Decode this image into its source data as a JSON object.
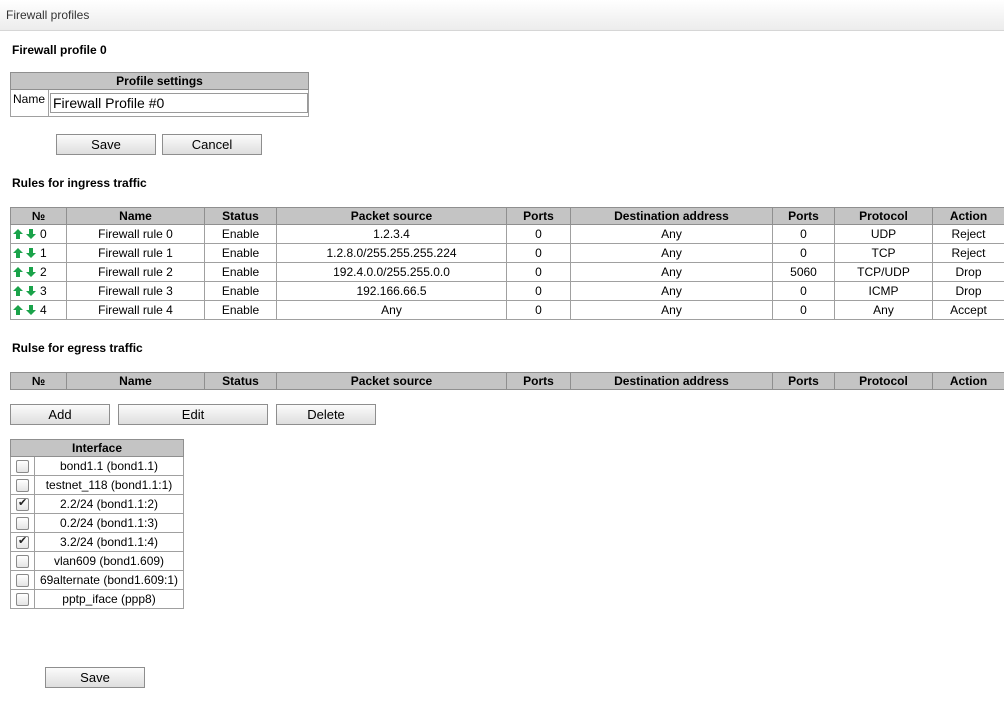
{
  "page": {
    "title": "Firewall profiles"
  },
  "profile": {
    "heading": "Firewall profile 0"
  },
  "profile_settings": {
    "header": "Profile settings",
    "name_label": "Name",
    "name_value": "Firewall Profile #0"
  },
  "buttons": {
    "save": "Save",
    "cancel": "Cancel",
    "add": "Add",
    "edit": "Edit",
    "delete": "Delete",
    "save_bottom": "Save"
  },
  "ingress": {
    "heading": "Rules for ingress traffic",
    "columns": [
      "№",
      "Name",
      "Status",
      "Packet source",
      "Ports",
      "Destination address",
      "Ports",
      "Protocol",
      "Action"
    ],
    "rows": [
      {
        "num": "0",
        "name": "Firewall rule 0",
        "status": "Enable",
        "source": "1.2.3.4",
        "src_ports": "0",
        "dest": "Any",
        "dst_ports": "0",
        "protocol": "UDP",
        "action": "Reject"
      },
      {
        "num": "1",
        "name": "Firewall rule 1",
        "status": "Enable",
        "source": "1.2.8.0/255.255.255.224",
        "src_ports": "0",
        "dest": "Any",
        "dst_ports": "0",
        "protocol": "TCP",
        "action": "Reject"
      },
      {
        "num": "2",
        "name": "Firewall rule 2",
        "status": "Enable",
        "source": "192.4.0.0/255.255.0.0",
        "src_ports": "0",
        "dest": "Any",
        "dst_ports": "5060",
        "protocol": "TCP/UDP",
        "action": "Drop"
      },
      {
        "num": "3",
        "name": "Firewall rule 3",
        "status": "Enable",
        "source": "192.166.66.5",
        "src_ports": "0",
        "dest": "Any",
        "dst_ports": "0",
        "protocol": "ICMP",
        "action": "Drop"
      },
      {
        "num": "4",
        "name": "Firewall rule 4",
        "status": "Enable",
        "source": "Any",
        "src_ports": "0",
        "dest": "Any",
        "dst_ports": "0",
        "protocol": "Any",
        "action": "Accept"
      }
    ]
  },
  "egress": {
    "heading": "Rulse for egress traffic",
    "columns": [
      "№",
      "Name",
      "Status",
      "Packet source",
      "Ports",
      "Destination address",
      "Ports",
      "Protocol",
      "Action"
    ]
  },
  "interfaces": {
    "header": "Interface",
    "items": [
      {
        "label": "bond1.1 (bond1.1)",
        "checked": false
      },
      {
        "label": "testnet_118 (bond1.1:1)",
        "checked": false
      },
      {
        "label": "2.2/24 (bond1.1:2)",
        "checked": true
      },
      {
        "label": "0.2/24 (bond1.1:3)",
        "checked": false
      },
      {
        "label": "3.2/24 (bond1.1:4)",
        "checked": true
      },
      {
        "label": "vlan609 (bond1.609)",
        "checked": false
      },
      {
        "label": "69alternate (bond1.609:1)",
        "checked": false
      },
      {
        "label": "pptp_iface (ppp8)",
        "checked": false
      }
    ]
  },
  "colors": {
    "arrow_green": "#1aa34a",
    "header_gray": "#c4c4c4"
  }
}
